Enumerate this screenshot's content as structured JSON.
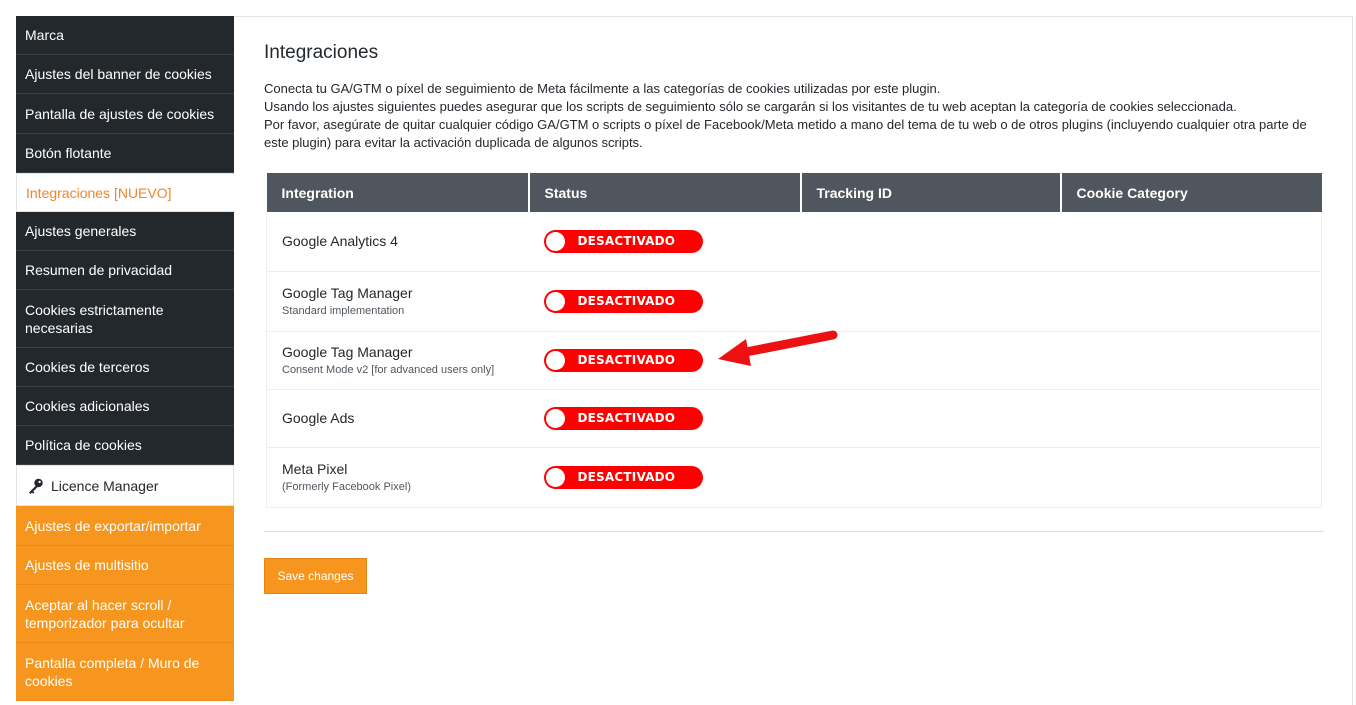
{
  "sidebar": {
    "items": [
      {
        "label": "Marca",
        "style": "dark"
      },
      {
        "label": "Ajustes del banner de cookies",
        "style": "dark"
      },
      {
        "label": "Pantalla de ajustes de cookies",
        "style": "dark"
      },
      {
        "label": "Botón flotante",
        "style": "dark"
      },
      {
        "label": "Integraciones [NUEVO]",
        "style": "active"
      },
      {
        "label": "Ajustes generales",
        "style": "dark"
      },
      {
        "label": "Resumen de privacidad",
        "style": "dark"
      },
      {
        "label": "Cookies estrictamente necesarias",
        "style": "dark"
      },
      {
        "label": "Cookies de terceros",
        "style": "dark"
      },
      {
        "label": "Cookies adicionales",
        "style": "dark"
      },
      {
        "label": "Política de cookies",
        "style": "dark"
      },
      {
        "label": "Licence Manager",
        "style": "light",
        "icon": "key-icon"
      },
      {
        "label": "Ajustes de exportar/importar",
        "style": "orange"
      },
      {
        "label": "Ajustes de multisitio",
        "style": "orange"
      },
      {
        "label": "Aceptar al hacer scroll / temporizador para ocultar",
        "style": "orange"
      },
      {
        "label": "Pantalla completa / Muro de cookies",
        "style": "orange"
      }
    ]
  },
  "main": {
    "title": "Integraciones",
    "description": [
      "Conecta tu GA/GTM o píxel de seguimiento de Meta fácilmente a las categorías de cookies utilizadas por este plugin.",
      "Usando los ajustes siguientes puedes asegurar que los scripts de seguimiento sólo se cargarán si los visitantes de tu web aceptan la categoría de cookies seleccionada.",
      "Por favor, asegúrate de quitar cualquier código GA/GTM o scripts o píxel de Facebook/Meta metido a mano del tema de tu web o de otros plugins (incluyendo cualquier otra parte de este plugin) para evitar la activación duplicada de algunos scripts."
    ],
    "table": {
      "headers": [
        "Integration",
        "Status",
        "Tracking ID",
        "Cookie Category"
      ],
      "rows": [
        {
          "name": "Google Analytics 4",
          "sub": "",
          "status": "DESACTIVADO"
        },
        {
          "name": "Google Tag Manager",
          "sub": "Standard implementation",
          "status": "DESACTIVADO"
        },
        {
          "name": "Google Tag Manager",
          "sub": "Consent Mode v2 [for advanced users only]",
          "status": "DESACTIVADO"
        },
        {
          "name": "Google Ads",
          "sub": "",
          "status": "DESACTIVADO"
        },
        {
          "name": "Meta Pixel",
          "sub": "(Formerly Facebook Pixel)",
          "status": "DESACTIVADO"
        }
      ]
    },
    "save_label": "Save changes"
  },
  "colors": {
    "sidebar_dark": "#23282d",
    "accent_orange": "#f7961e",
    "active_text": "#f2852b",
    "toggle_off": "#ff0000",
    "table_header": "#50565d",
    "annotation_arrow": "#ee1111"
  }
}
